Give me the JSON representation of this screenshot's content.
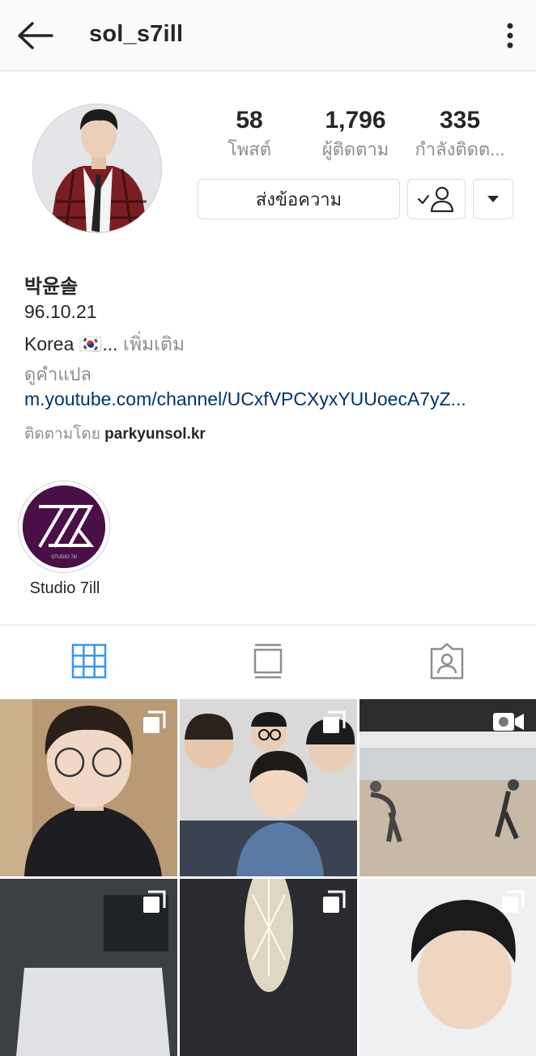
{
  "header": {
    "username": "sol_s7ill",
    "back_icon": "arrow-left-icon",
    "more_icon": "more-vertical-icon"
  },
  "profile": {
    "stats": [
      {
        "value": "58",
        "label": "โพสต์"
      },
      {
        "value": "1,796",
        "label": "ผู้ติดตาม"
      },
      {
        "value": "335",
        "label": "กำลังติดต..."
      }
    ],
    "message_button": "ส่งข้อความ",
    "following_icon": "user-check-icon",
    "dropdown_icon": "caret-down-icon"
  },
  "bio": {
    "name": "박윤솔",
    "birthday": "96.10.21",
    "country_text": "Korea",
    "flag": "🇰🇷",
    "ellipsis": "...",
    "more_label": "เพิ่มเติม",
    "translate": "ดูคำแปล",
    "link": "m.youtube.com/channel/UCxfVPCXyxYUUoecA7yZ...",
    "followed_prefix": "ติดตามโดย",
    "followed_by": "parkyunsol.kr"
  },
  "highlights": [
    {
      "label": "Studio 7ill",
      "logo_text": "STUDIO 7ill"
    }
  ],
  "tabs": [
    {
      "name": "grid",
      "icon": "grid-icon",
      "active": true
    },
    {
      "name": "feed",
      "icon": "feed-icon",
      "active": false
    },
    {
      "name": "tagged",
      "icon": "tagged-user-icon",
      "active": false
    }
  ],
  "posts": [
    {
      "type": "multi",
      "badge_icon": "carousel-icon",
      "alt": "selfie with round glasses"
    },
    {
      "type": "multi",
      "badge_icon": "carousel-icon",
      "alt": "group selfie"
    },
    {
      "type": "video",
      "badge_icon": "video-camera-icon",
      "alt": "dance practice room"
    },
    {
      "type": "multi",
      "badge_icon": "carousel-icon",
      "alt": "cake with box"
    },
    {
      "type": "multi",
      "badge_icon": "carousel-icon",
      "alt": "sparkler"
    },
    {
      "type": "multi",
      "badge_icon": "carousel-icon",
      "alt": "portrait"
    }
  ],
  "colors": {
    "link": "#003569",
    "active_tab": "#3897f0",
    "muted": "#8e8e8e",
    "highlight_bg": "#4b0f47"
  }
}
